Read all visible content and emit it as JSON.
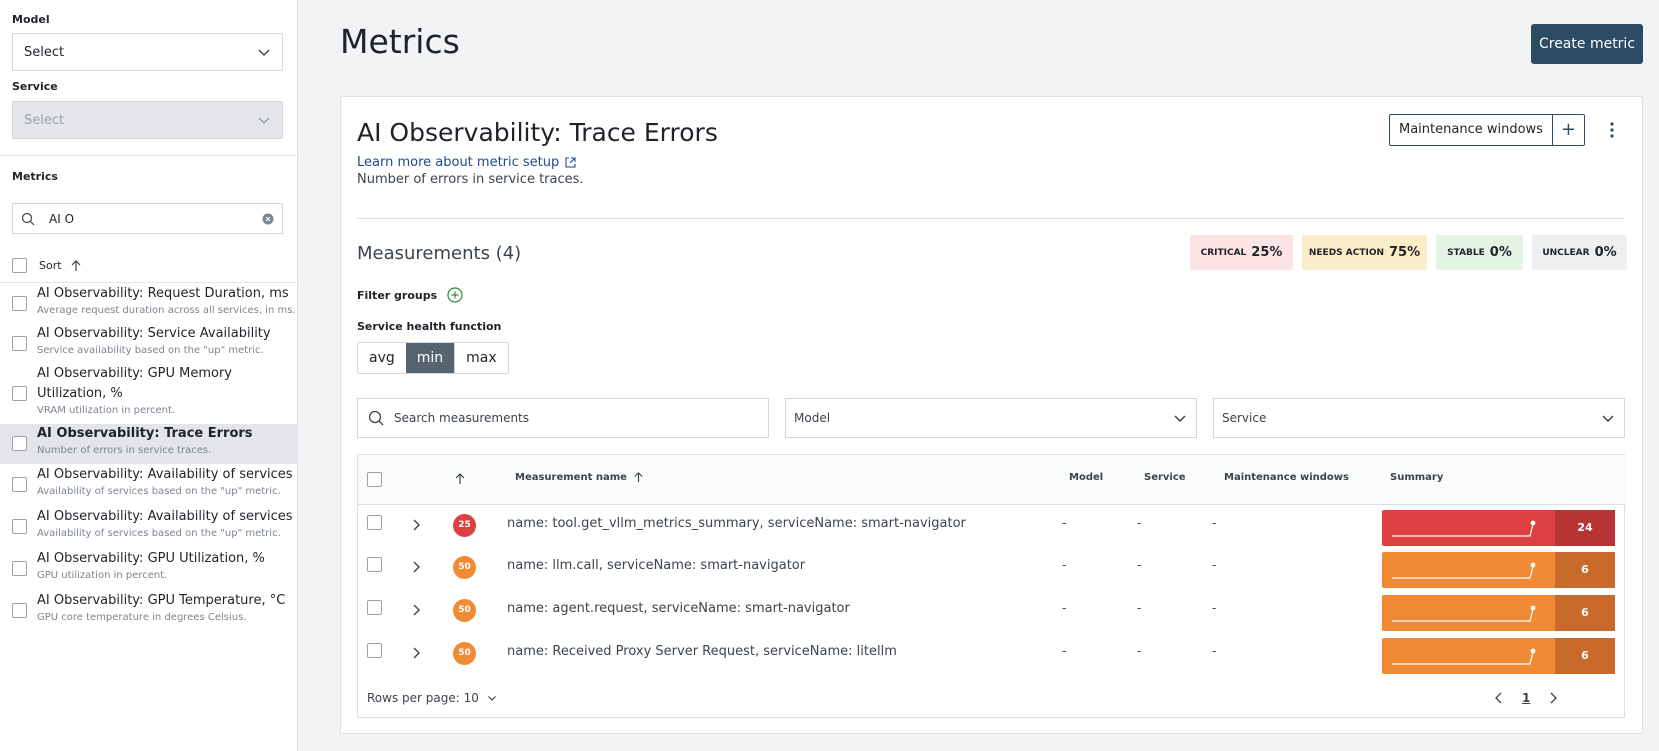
{
  "sidebar": {
    "model_label": "Model",
    "model_value": "Select",
    "service_label": "Service",
    "service_value": "Select",
    "metrics_label": "Metrics",
    "search_value": "AI O",
    "sort_label": "Sort",
    "items": [
      {
        "title": "AI Observability: Request Duration, ms",
        "desc": "Average request duration across all services, in ms."
      },
      {
        "title": "AI Observability: Service Availability",
        "desc": "Service availability based on the \"up\" metric."
      },
      {
        "title": "AI Observability: GPU Memory",
        "title2": "Utilization, %",
        "desc": "VRAM utilization in percent."
      },
      {
        "title": "AI Observability: Trace Errors",
        "desc": "Number of errors in service traces."
      },
      {
        "title": "AI Observability: Availability of services",
        "desc": "Availability of services based on the \"up\" metric."
      },
      {
        "title": "AI Observability: Availability of services",
        "desc": "Availability of services based on the \"up\" metric."
      },
      {
        "title": "AI Observability: GPU Utilization, %",
        "desc": "GPU utilization in percent."
      },
      {
        "title": "AI Observability: GPU Temperature, °C",
        "desc": "GPU core temperature in degrees Celsius."
      }
    ]
  },
  "header": {
    "title": "Metrics",
    "create_button": "Create metric"
  },
  "detail": {
    "title": "AI Observability: Trace Errors",
    "learn_more": "Learn more about metric setup",
    "description": "Number of errors in service traces.",
    "maintenance_button": "Maintenance windows",
    "measurements_heading": "Measurements (4)",
    "status": {
      "critical_label": "CRITICAL",
      "critical_value": "25%",
      "needs_label": "NEEDS ACTION",
      "needs_value": "75%",
      "stable_label": "STABLE",
      "stable_value": "0%",
      "unclear_label": "UNCLEAR",
      "unclear_value": "0%"
    },
    "filter_groups": "Filter groups",
    "health_function_label": "Service health function",
    "health_options": [
      "avg",
      "min",
      "max"
    ],
    "health_selected": "min",
    "search_placeholder": "Search measurements",
    "model_filter": "Model",
    "service_filter": "Service"
  },
  "table": {
    "headers": {
      "name": "Measurement name",
      "model": "Model",
      "service": "Service",
      "maintenance": "Maintenance windows",
      "summary": "Summary"
    },
    "rows": [
      {
        "badge": "25",
        "name": "name: tool.get_vllm_metrics_summary, serviceName: smart-navigator",
        "model": "-",
        "service": "-",
        "maintenance": "-",
        "summary": "24",
        "status": "critical"
      },
      {
        "badge": "50",
        "name": "name: llm.call, serviceName: smart-navigator",
        "model": "-",
        "service": "-",
        "maintenance": "-",
        "summary": "6",
        "status": "needs"
      },
      {
        "badge": "50",
        "name": "name: agent.request, serviceName: smart-navigator",
        "model": "-",
        "service": "-",
        "maintenance": "-",
        "summary": "6",
        "status": "needs"
      },
      {
        "badge": "50",
        "name": "name: Received Proxy Server Request, serviceName: litellm",
        "model": "-",
        "service": "-",
        "maintenance": "-",
        "summary": "6",
        "status": "needs"
      }
    ],
    "rows_per_page": "Rows per page: 10",
    "page": "1"
  },
  "colors": {
    "primary": "#2c4c63",
    "critical": "#dc4040",
    "needs_action": "#f08a35",
    "critical_bg": "#fde3e3",
    "needs_bg": "#fdecc8",
    "stable_bg": "#e3f3e4",
    "unclear_bg": "#eeeff0"
  }
}
